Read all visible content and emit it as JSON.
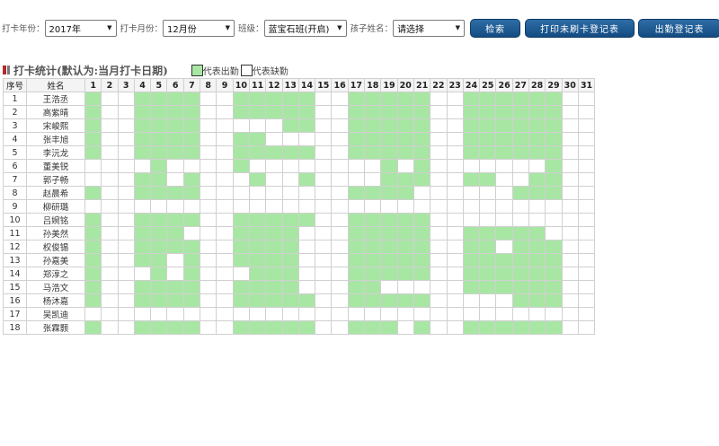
{
  "filters": {
    "year_label": "打卡年份：",
    "year_value": "2017年",
    "month_label": "打卡月份：",
    "month_value": "12月份",
    "class_label": "班级：",
    "class_value": "蓝宝石班(开启)",
    "child_label": "孩子姓名：",
    "child_value": "请选择"
  },
  "buttons": {
    "search": "检索",
    "print_missing": "打印未刷卡登记表",
    "attendance_register": "出勤登记表"
  },
  "section": {
    "title": "打卡统计(默认为:当月打卡日期)",
    "legend_present": "代表出勤",
    "legend_absent": "代表缺勤"
  },
  "colors": {
    "present": "#a8e6a4",
    "absent": "#ffffff",
    "button": "#1e5a93"
  },
  "table": {
    "col_index": "序号",
    "col_name": "姓名",
    "days": [
      "1",
      "2",
      "3",
      "4",
      "5",
      "6",
      "7",
      "8",
      "9",
      "10",
      "11",
      "12",
      "13",
      "14",
      "15",
      "16",
      "17",
      "18",
      "19",
      "20",
      "21",
      "22",
      "23",
      "24",
      "25",
      "26",
      "27",
      "28",
      "29",
      "30",
      "31"
    ],
    "rows": [
      {
        "no": "1",
        "name": "王浩丞",
        "att": "1001111001111100111110011111100"
      },
      {
        "no": "2",
        "name": "高紫晴",
        "att": "1001111001111100111110011111100"
      },
      {
        "no": "3",
        "name": "宋峻熙",
        "att": "1001111000001100111110011111100"
      },
      {
        "no": "4",
        "name": "张丰旭",
        "att": "1001111001100000111110011111100"
      },
      {
        "no": "5",
        "name": "李沅龙",
        "att": "1001111001111100111110011111100"
      },
      {
        "no": "6",
        "name": "董美锐",
        "att": "0000100001000000001010000000100"
      },
      {
        "no": "7",
        "name": "郭子畅",
        "att": "0001101000100100001110011001100"
      },
      {
        "no": "8",
        "name": "赵晨希",
        "att": "1001111000000000111100000011100"
      },
      {
        "no": "9",
        "name": "柳研璐",
        "att": "0000000000000000000000000000000"
      },
      {
        "no": "10",
        "name": "吕婉铭",
        "att": "1001111001111100111110000000000"
      },
      {
        "no": "11",
        "name": "孙美然",
        "att": "1001110001111000111110011111000"
      },
      {
        "no": "12",
        "name": "权俊锡",
        "att": "1001111001111000111110011011100"
      },
      {
        "no": "13",
        "name": "孙嘉美",
        "att": "1001101001111000111110011111100"
      },
      {
        "no": "14",
        "name": "郑淳之",
        "att": "1000101000111000111110011111100"
      },
      {
        "no": "15",
        "name": "马浩文",
        "att": "1001111001111000110000011111100"
      },
      {
        "no": "16",
        "name": "杨沐嘉",
        "att": "1001111001111100111110000011100"
      },
      {
        "no": "17",
        "name": "吴凯迪",
        "att": "0000000000000000000000000000000"
      },
      {
        "no": "18",
        "name": "张霖颢",
        "att": "1001111001111100111010011111100"
      }
    ]
  }
}
